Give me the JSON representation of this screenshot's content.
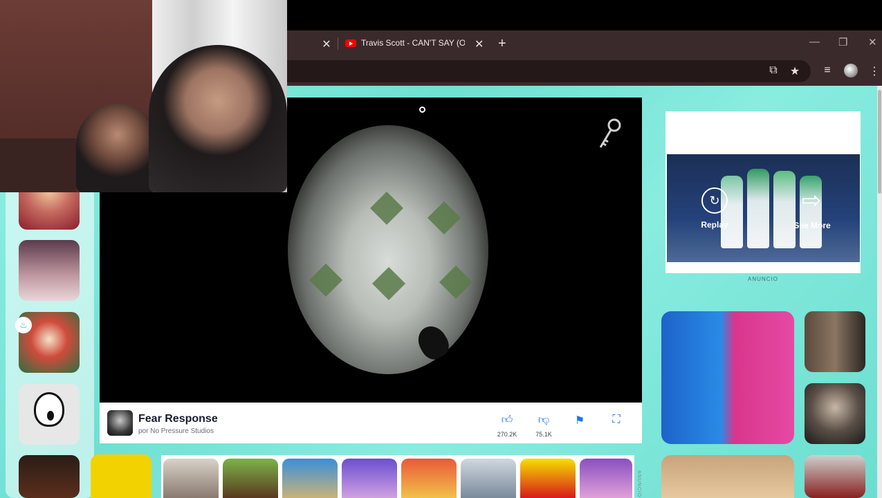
{
  "browser": {
    "active_tab_title": "Travis Scott - CAN'T SAY (Official",
    "close_glyph": "✕",
    "new_tab_glyph": "+",
    "window_controls": [
      "—",
      "❐",
      "✕"
    ]
  },
  "game": {
    "title": "Fear Response",
    "developer": "por No Pressure Studios",
    "likes": "270.2K",
    "dislikes": "75.1K"
  },
  "ad": {
    "replay_label": "Replay",
    "see_more_label": "See More",
    "label": "ANUNCIO",
    "vertical_label": "ANUNCIO"
  },
  "icons": {
    "accent_color": "#1a74f0",
    "page_bg": "#7de8da"
  }
}
